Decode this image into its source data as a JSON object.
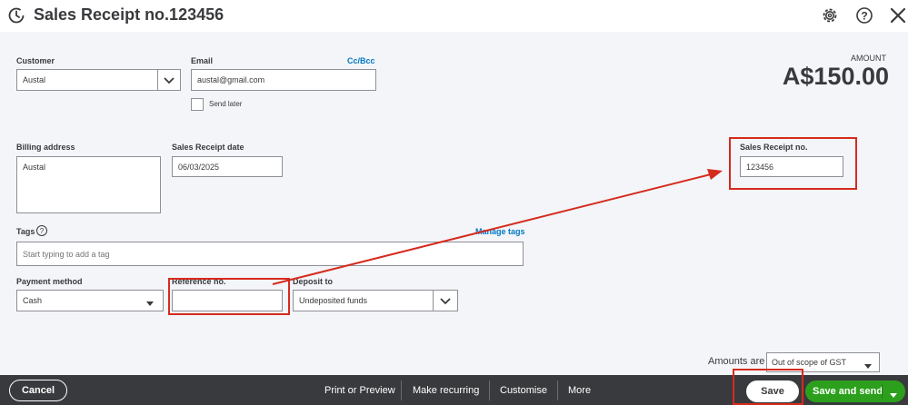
{
  "header": {
    "title": "Sales Receipt no.123456",
    "icons": [
      "history-icon",
      "gear-icon",
      "help-icon",
      "close-icon"
    ]
  },
  "customer": {
    "label": "Customer",
    "value": "Austal"
  },
  "email": {
    "label": "Email",
    "value": "austal@gmail.com",
    "cc_bcc": "Cc/Bcc",
    "send_later": "Send later",
    "send_later_checked": false
  },
  "amount": {
    "label": "AMOUNT",
    "value": "A$150.00"
  },
  "billing_address": {
    "label": "Billing address",
    "value": "Austal"
  },
  "receipt_date": {
    "label": "Sales Receipt date",
    "value": "06/03/2025"
  },
  "receipt_no": {
    "label": "Sales Receipt no.",
    "value": "123456"
  },
  "tags": {
    "label": "Tags",
    "help": "?",
    "placeholder": "Start typing to add a tag",
    "manage": "Manage tags"
  },
  "payment_method": {
    "label": "Payment method",
    "value": "Cash"
  },
  "reference_no": {
    "label": "Reference no.",
    "value": ""
  },
  "deposit_to": {
    "label": "Deposit to",
    "value": "Undeposited funds"
  },
  "amounts_are": {
    "label": "Amounts are",
    "value": "Out of scope of GST"
  },
  "footer": {
    "cancel": "Cancel",
    "print_preview": "Print or Preview",
    "make_recurring": "Make recurring",
    "customise": "Customise",
    "more": "More",
    "save": "Save",
    "save_and_send": "Save and send"
  },
  "colors": {
    "accent_green": "#2ca01c",
    "annotation_red": "#d52b1e",
    "footer_bg": "#393a3d",
    "link_blue": "#0077c5"
  }
}
